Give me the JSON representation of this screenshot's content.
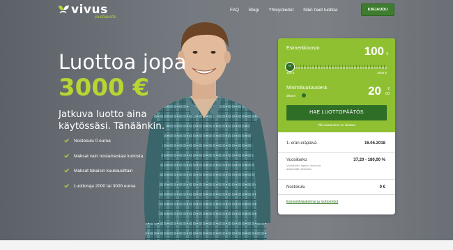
{
  "header": {
    "logo_text": "vivus",
    "logo_sub": "joustoluotto",
    "nav": [
      "FAQ",
      "Blogi",
      "Yhteystiedot",
      "Näin haet luottoa"
    ],
    "login_label": "KIRJAUDU"
  },
  "hero": {
    "headline_line1": "Luottoa jopa",
    "headline_line2": "3000 €",
    "subline": "Jatkuva luotto aina käytössäsi. Tänäänkin.",
    "bullets": [
      "Nostokulu 0 euroa",
      "Maksat vain nostamastasi luotosta",
      "Maksat takaisin kuukausittain",
      "Luottoraja 2000 tai 3000 euroa"
    ]
  },
  "calculator": {
    "example_label": "Esimerkkinosto",
    "example_value": "100",
    "example_currency": "€",
    "slider_fraction": 0.0,
    "range_min": "100 €",
    "range_max": "3000 €",
    "installment_label": "Minimikuukausierä",
    "installment_sub": "alkaen",
    "installment_value": "20",
    "installment_currency": "€",
    "installment_decimals": ",00",
    "apply_button": "HAE LUOTTOPÄÄTÖS",
    "apply_note": "Tilin avaaminen on ilmaista",
    "due_label": "1. erän eräpäivä",
    "due_value": "16.05.2018",
    "apr_label": "Vuosikorko",
    "apr_sub": "Vuosikorko riippuu luoton ja asiakastilin tiedoista",
    "apr_value": "37,20 - 180,00 %",
    "fee_label": "Nostokulu",
    "fee_value": "0 €",
    "terms_link": "Esimerkkilaskelmat ja luottoehdot"
  },
  "colors": {
    "accent_green": "#8fc032",
    "dark_green": "#2f6e27",
    "headline_green": "#b8d532"
  }
}
